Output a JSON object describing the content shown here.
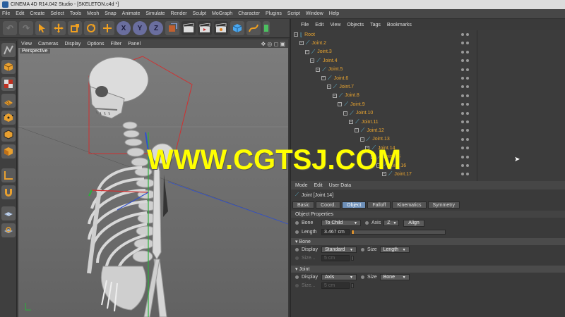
{
  "titlebar": {
    "title": "CINEMA 4D R14.042 Studio - [SKELETON.c4d *]"
  },
  "menubar": [
    "File",
    "Edit",
    "Create",
    "Select",
    "Tools",
    "Mesh",
    "Snap",
    "Animate",
    "Simulate",
    "Render",
    "Sculpt",
    "MoGraph",
    "Character",
    "Plugins",
    "Script",
    "Window",
    "Help"
  ],
  "toolbar": {
    "undo": "↶",
    "redo": "↷",
    "axis_x": "X",
    "axis_y": "Y",
    "axis_z": "Z"
  },
  "viewport": {
    "menu": [
      "View",
      "Cameras",
      "Display",
      "Options",
      "Filter",
      "Panel"
    ],
    "label": "Perspective",
    "watermark": "WWW.CGTSJ.COM"
  },
  "object_manager": {
    "menu": [
      "File",
      "Edit",
      "View",
      "Objects",
      "Tags",
      "Bookmarks"
    ],
    "items": [
      "Root",
      "Joint.2",
      "Joint.3",
      "Joint.4",
      "Joint.5",
      "Joint.6",
      "Joint.7",
      "Joint.8",
      "Joint.9",
      "Joint.10",
      "Joint.11",
      "Joint.12",
      "Joint.13",
      "Joint.14",
      "Joint.15",
      "Joint.16",
      "Joint.17"
    ]
  },
  "attribute_manager": {
    "menu": [
      "Mode",
      "Edit",
      "User Data"
    ],
    "title": "Joint [Joint.14]",
    "tabs": [
      "Basic",
      "Coord.",
      "Object",
      "Falloff",
      "Kinematics",
      "Symmetry"
    ],
    "active_tab": "Object",
    "section_object": "Object Properties",
    "bone_label": "Bone",
    "bone_value": "To Child",
    "axis_label": "Axis",
    "axis_value": "Z",
    "align_button": "Align",
    "length_label": "Length",
    "length_value": "3.467 cm",
    "section_bone": "Bone",
    "display_label": "Display",
    "bone_display_value": "Standard",
    "size_label": "Size",
    "bone_size_value": "Length",
    "size_field_label": "Size...",
    "size_field_value": "5 cm",
    "section_joint": "Joint",
    "joint_display_value": "Axis",
    "joint_size_value": "Bone",
    "joint_size_field_value": "5 cm"
  }
}
